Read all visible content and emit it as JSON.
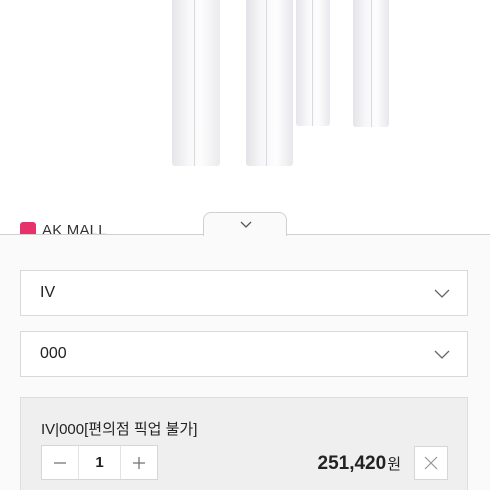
{
  "mall": {
    "name": "AK MALL",
    "logo_color": "#e8316a"
  },
  "options": [
    {
      "value": "IV",
      "icon": "chevron-down-icon"
    },
    {
      "value": "000",
      "icon": "chevron-down-icon"
    }
  ],
  "selected_item": {
    "title": "IV|000[편의점 픽업 불가]",
    "quantity": "1",
    "price": "251,420",
    "currency": "원",
    "icons": {
      "decrease": "minus-icon",
      "increase": "plus-icon",
      "remove": "close-icon"
    }
  },
  "sheet": {
    "toggle_icon": "chevron-down-icon"
  }
}
